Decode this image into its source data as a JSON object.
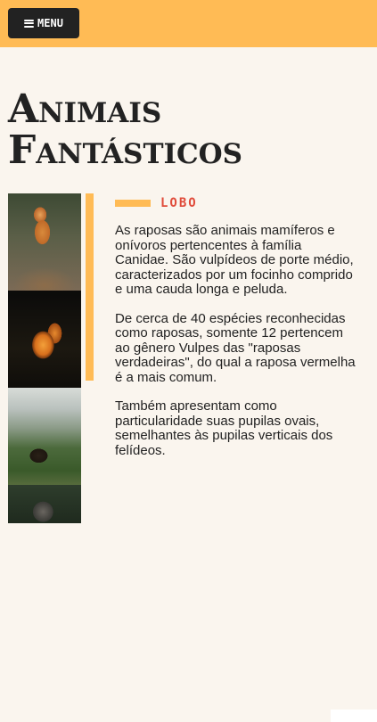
{
  "header": {
    "menu_label": "MENU",
    "menu_icon": "hamburger-icon",
    "accent_color": "#ffbb55"
  },
  "page": {
    "title_line1": "Animais",
    "title_line2": "Fantásticos"
  },
  "gallery": {
    "photos": [
      "fox-photo",
      "squirrel-photo",
      "bear-photo",
      "wolf-photo"
    ]
  },
  "article": {
    "label": "LOBO",
    "label_color": "#e04b3a",
    "paragraphs": [
      "As raposas são animais mamíferos e onívoros pertencentes à família Canidae. São vulpídeos de porte médio, caracterizados por um focinho comprido e uma cauda longa e peluda.",
      "De cerca de 40 espécies reconhecidas como raposas, somente 12 pertencem ao gênero Vulpes das \"raposas verdadeiras\", do qual a raposa vermelha é a mais comum.",
      "Também apresentam como particularidade suas pupilas ovais, semelhantes às pupilas verticais dos felídeos."
    ]
  }
}
